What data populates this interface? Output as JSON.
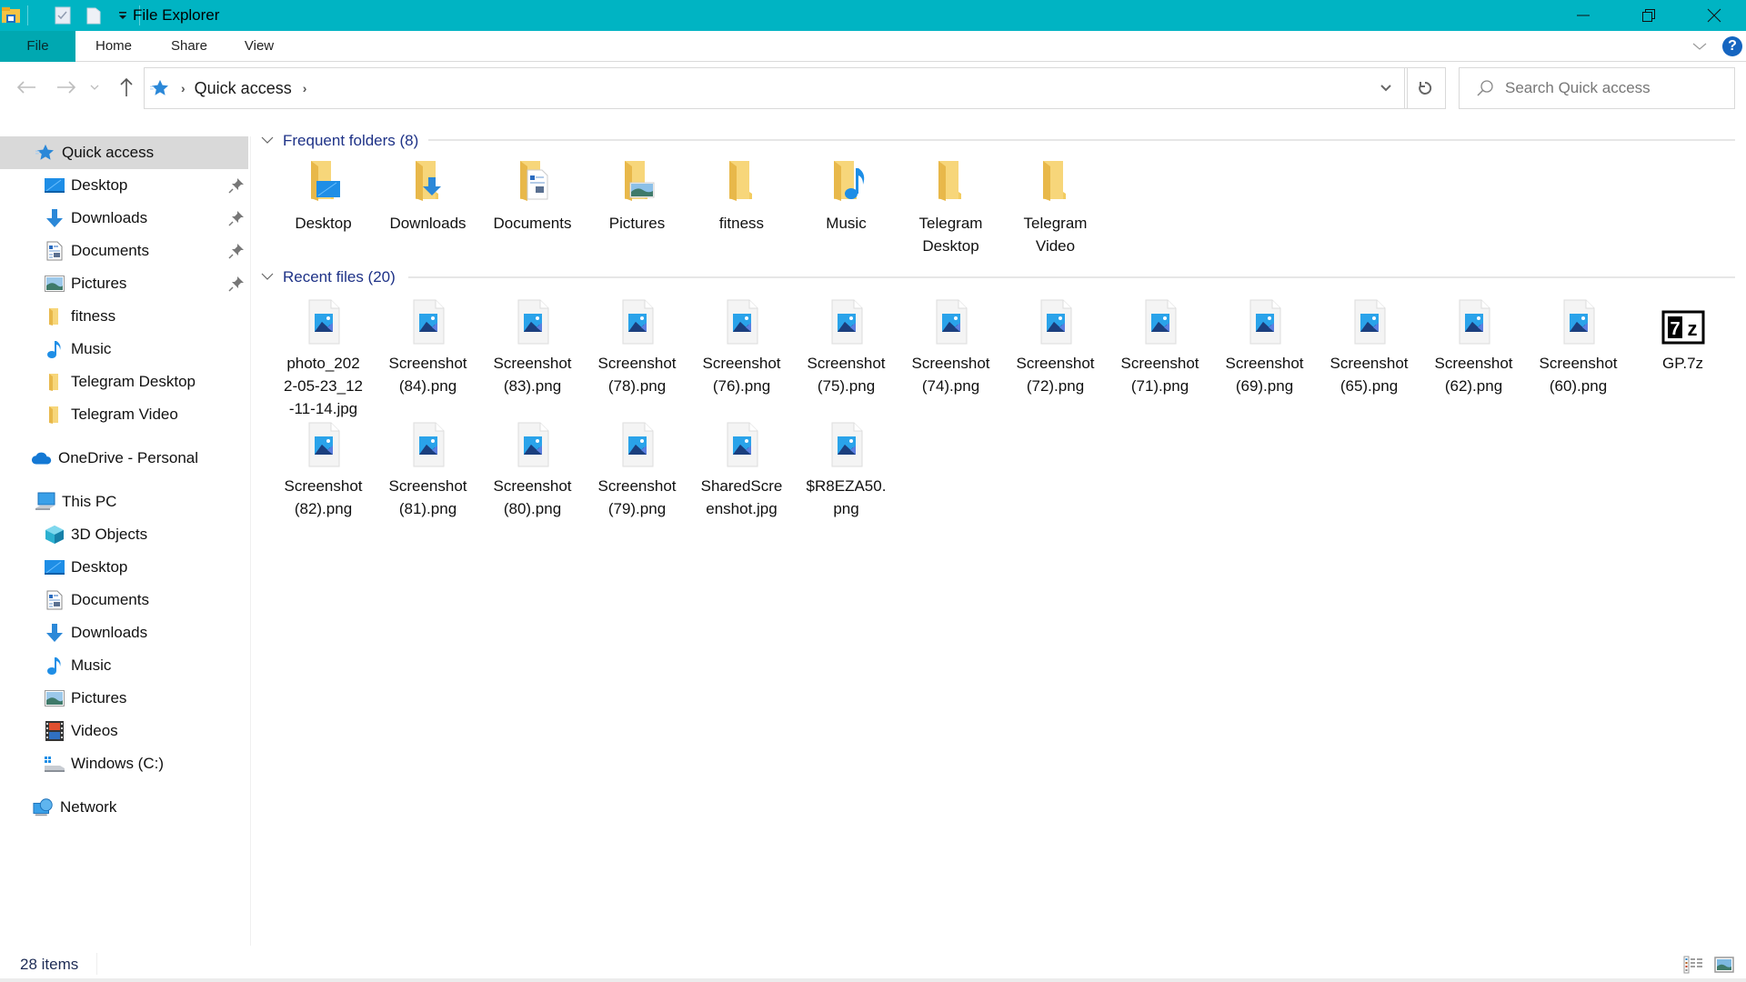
{
  "window": {
    "title": "File Explorer",
    "accent_color": "#00b4c3",
    "file_tab_color": "#00a8b1"
  },
  "qat": {
    "icons": [
      "file-explorer-icon",
      "properties-icon",
      "new-folder-icon",
      "customize-qat-icon"
    ]
  },
  "ribbon": {
    "tabs": [
      {
        "label": "File"
      },
      {
        "label": "Home"
      },
      {
        "label": "Share"
      },
      {
        "label": "View"
      }
    ],
    "help_label": "?"
  },
  "navigation": {
    "breadcrumb": [
      {
        "label": "Quick access"
      }
    ],
    "search_placeholder": "Search Quick access"
  },
  "sidebar": {
    "items": [
      {
        "label": "Quick access",
        "icon": "star-icon",
        "selected": true,
        "pinned": false
      },
      {
        "label": "Desktop",
        "icon": "desktop-icon",
        "pinned": true
      },
      {
        "label": "Downloads",
        "icon": "download-icon",
        "pinned": true
      },
      {
        "label": "Documents",
        "icon": "documents-icon",
        "pinned": true
      },
      {
        "label": "Pictures",
        "icon": "pictures-icon",
        "pinned": true
      },
      {
        "label": "fitness",
        "icon": "folder-icon",
        "pinned": false
      },
      {
        "label": "Music",
        "icon": "music-icon",
        "pinned": false
      },
      {
        "label": "Telegram Desktop",
        "icon": "folder-icon",
        "pinned": false
      },
      {
        "label": "Telegram Video",
        "icon": "folder-icon",
        "pinned": false
      },
      {
        "label": "OneDrive - Personal",
        "icon": "onedrive-icon"
      },
      {
        "label": "This PC",
        "icon": "this-pc-icon"
      },
      {
        "label": "3D Objects",
        "icon": "3d-objects-icon"
      },
      {
        "label": "Desktop",
        "icon": "desktop-icon"
      },
      {
        "label": "Documents",
        "icon": "documents-icon"
      },
      {
        "label": "Downloads",
        "icon": "download-icon"
      },
      {
        "label": "Music",
        "icon": "music-icon"
      },
      {
        "label": "Pictures",
        "icon": "pictures-icon"
      },
      {
        "label": "Videos",
        "icon": "videos-icon"
      },
      {
        "label": "Windows (C:)",
        "icon": "drive-icon"
      },
      {
        "label": "Network",
        "icon": "network-icon"
      }
    ]
  },
  "content": {
    "frequent": {
      "title": "Frequent folders (8)",
      "items": [
        {
          "label": "Desktop",
          "icon": "desktop"
        },
        {
          "label": "Downloads",
          "icon": "downloads"
        },
        {
          "label": "Documents",
          "icon": "documents"
        },
        {
          "label": "Pictures",
          "icon": "pictures"
        },
        {
          "label": "fitness",
          "icon": "plain"
        },
        {
          "label": "Music",
          "icon": "music"
        },
        {
          "label": "Telegram\nDesktop",
          "icon": "plain"
        },
        {
          "label": "Telegram\nVideo",
          "icon": "plain"
        }
      ]
    },
    "recent": {
      "title": "Recent files (20)",
      "items": [
        {
          "label": "photo_202\n2-05-23_12\n-11-14.jpg",
          "icon": "image"
        },
        {
          "label": "Screenshot\n(84).png",
          "icon": "image"
        },
        {
          "label": "Screenshot\n(83).png",
          "icon": "image"
        },
        {
          "label": "Screenshot\n(78).png",
          "icon": "image"
        },
        {
          "label": "Screenshot\n(76).png",
          "icon": "image"
        },
        {
          "label": "Screenshot\n(75).png",
          "icon": "image"
        },
        {
          "label": "Screenshot\n(74).png",
          "icon": "image"
        },
        {
          "label": "Screenshot\n(72).png",
          "icon": "image"
        },
        {
          "label": "Screenshot\n(71).png",
          "icon": "image"
        },
        {
          "label": "Screenshot\n(69).png",
          "icon": "image"
        },
        {
          "label": "Screenshot\n(65).png",
          "icon": "image"
        },
        {
          "label": "Screenshot\n(62).png",
          "icon": "image"
        },
        {
          "label": "Screenshot\n(60).png",
          "icon": "image"
        },
        {
          "label": "GP.7z",
          "icon": "7z"
        },
        {
          "label": "Screenshot\n(82).png",
          "icon": "image"
        },
        {
          "label": "Screenshot\n(81).png",
          "icon": "image"
        },
        {
          "label": "Screenshot\n(80).png",
          "icon": "image"
        },
        {
          "label": "Screenshot\n(79).png",
          "icon": "image"
        },
        {
          "label": "SharedScre\nenshot.jpg",
          "icon": "image"
        },
        {
          "label": "$R8EZA50.\npng",
          "icon": "image"
        }
      ]
    }
  },
  "status": {
    "item_count": "28 items",
    "active_view": "large-icons"
  }
}
